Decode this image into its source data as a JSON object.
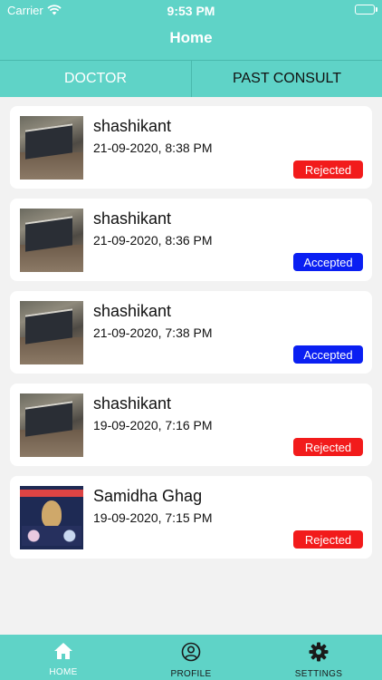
{
  "status": {
    "carrier": "Carrier",
    "time": "9:53 PM"
  },
  "header": {
    "title": "Home"
  },
  "tabs": [
    {
      "label": "DOCTOR"
    },
    {
      "label": "PAST CONSULT"
    }
  ],
  "consults": [
    {
      "name": "shashikant",
      "datetime": "21-09-2020, 8:38 PM",
      "status": "Rejected"
    },
    {
      "name": "shashikant",
      "datetime": "21-09-2020, 8:36 PM",
      "status": "Accepted"
    },
    {
      "name": "shashikant",
      "datetime": "21-09-2020, 7:38 PM",
      "status": "Accepted"
    },
    {
      "name": "shashikant",
      "datetime": "19-09-2020, 7:16 PM",
      "status": "Rejected"
    },
    {
      "name": "Samidha Ghag",
      "datetime": "19-09-2020, 7:15 PM",
      "status": "Rejected"
    }
  ],
  "bottom_nav": [
    {
      "label": "HOME",
      "icon": "home-icon"
    },
    {
      "label": "PROFILE",
      "icon": "profile-icon"
    },
    {
      "label": "SETTINGS",
      "icon": "gear-icon"
    }
  ],
  "colors": {
    "teal": "#5fd3c7",
    "rejected": "#f21b1b",
    "accepted": "#0a1ff2"
  }
}
